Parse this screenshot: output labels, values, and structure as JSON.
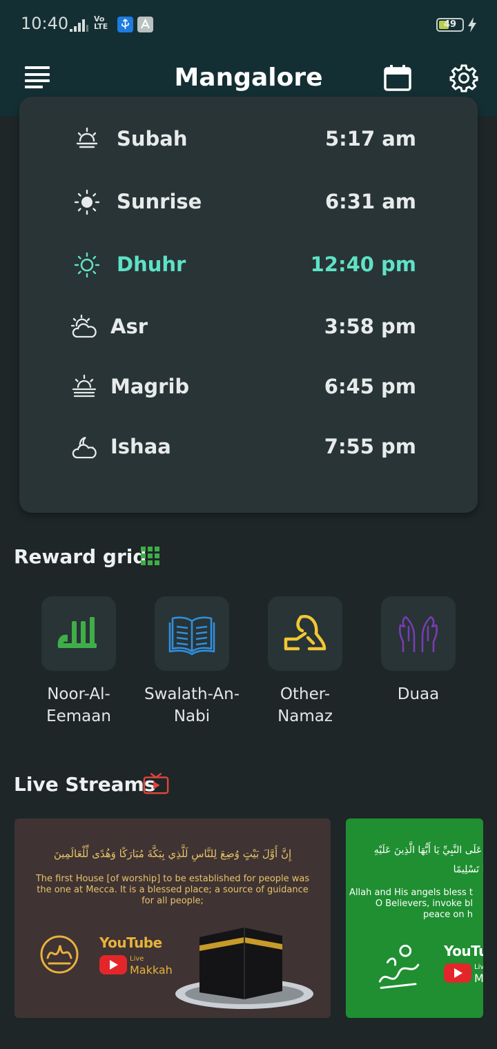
{
  "status_bar": {
    "time": "10:40",
    "network": "Vo LTE",
    "battery": "49",
    "icons": [
      "signal-icon",
      "usb-icon",
      "app-store-icon",
      "battery-icon",
      "charging-icon"
    ]
  },
  "app_bar": {
    "title": "Mangalore",
    "icons": [
      "menu-icon",
      "calendar-icon",
      "gear-icon"
    ]
  },
  "prayers": [
    {
      "name": "Subah",
      "time": "5:17 am",
      "icon": "dawn-icon",
      "active": false
    },
    {
      "name": "Sunrise",
      "time": "6:31 am",
      "icon": "sun-icon",
      "active": false
    },
    {
      "name": "Dhuhr",
      "time": "12:40 pm",
      "icon": "sun-outline-icon",
      "active": true
    },
    {
      "name": "Asr",
      "time": "3:58 pm",
      "icon": "sun-cloud-icon",
      "active": false
    },
    {
      "name": "Magrib",
      "time": "6:45 pm",
      "icon": "sunset-icon",
      "active": false
    },
    {
      "name": "Ishaa",
      "time": "7:55 pm",
      "icon": "moon-cloud-icon",
      "active": false
    }
  ],
  "reward_grid": {
    "title": "Reward grid",
    "items": [
      {
        "label": "Noor-Al-Eemaan",
        "icon": "allah-calligraphy-icon",
        "color": "#3fae49"
      },
      {
        "label": "Swalath-An-Nabi",
        "icon": "open-book-icon",
        "color": "#2f8fe0"
      },
      {
        "label": "Other-Namaz",
        "icon": "prayer-person-icon",
        "color": "#f2c733"
      },
      {
        "label": "Duaa",
        "icon": "praying-hands-icon",
        "color": "#7a3bb4"
      }
    ]
  },
  "live_streams": {
    "title": "Live Streams",
    "streams": [
      {
        "arabic": "إِنَّ أَوَّلَ بَيْتٍ وُضِعَ لِلنَّاسِ لَلَّذِي بِبَكَّةَ مُبَارَكًا وَهُدًى لِّلْعَالَمِينَ",
        "text": "The first House [of worship] to be established for people was the one at Mecca. It is a blessed place; a source of guidance for all people;",
        "brand": "YouTube",
        "live": "Live",
        "city": "Makkah"
      },
      {
        "arabic": "يُصَلُّونَ عَلَى النَّبِيِّ يَا أَيُّهَا الَّذِينَ عَلَيْهِ وَسَلِّمُوا تَسْلِيمًا",
        "text": "Allah and His angels bless t O Believers, invoke bl peace on h",
        "brand": "YouTub",
        "live": "Liv",
        "city": "M"
      }
    ]
  },
  "colors": {
    "background": "#1e2628",
    "app_bar": "#142f33",
    "card": "#293436",
    "active_prayer": "#5fe2c6",
    "youtube_red": "#e3262a"
  }
}
